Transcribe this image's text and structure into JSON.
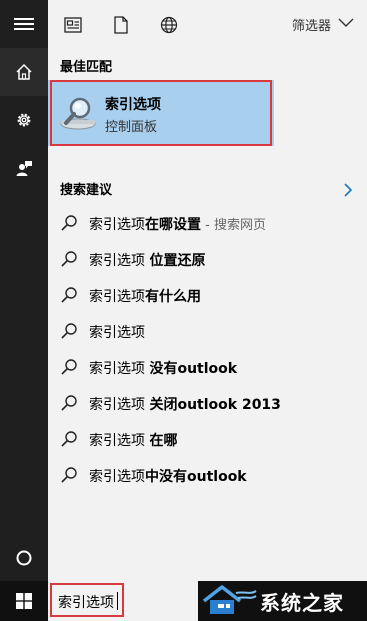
{
  "toolbar": {
    "icons": [
      "news-icon",
      "document-icon",
      "globe-icon"
    ],
    "filter_label": "筛选器"
  },
  "best_match": {
    "section_label": "最佳匹配",
    "title": "索引选项",
    "subtitle": "控制面板"
  },
  "suggestions": {
    "section_label": "搜索建议",
    "items": [
      {
        "prefix": "索引选项",
        "bold": "在哪设置",
        "suffix": " - 搜索网页"
      },
      {
        "prefix": "索引选项 ",
        "bold": "位置还原",
        "suffix": ""
      },
      {
        "prefix": "索引选项",
        "bold": "有什么用",
        "suffix": ""
      },
      {
        "prefix": "索引选项",
        "bold": "",
        "suffix": ""
      },
      {
        "prefix": "索引选项 ",
        "bold": "没有outlook",
        "suffix": ""
      },
      {
        "prefix": "索引选项 ",
        "bold": "关闭outlook 2013",
        "suffix": ""
      },
      {
        "prefix": "索引选项 ",
        "bold": "在哪",
        "suffix": ""
      },
      {
        "prefix": "索引选项",
        "bold": "中没有outlook",
        "suffix": ""
      }
    ]
  },
  "taskbar": {
    "search_value": "索引选项",
    "watermark_text": "系统之家"
  },
  "colors": {
    "rail_bg": "#1f1f1f",
    "panel_bg": "#f2f2f2",
    "highlight_bg": "#a9cfee",
    "outline_red": "#d9383e",
    "accent_blue": "#1e73be"
  }
}
